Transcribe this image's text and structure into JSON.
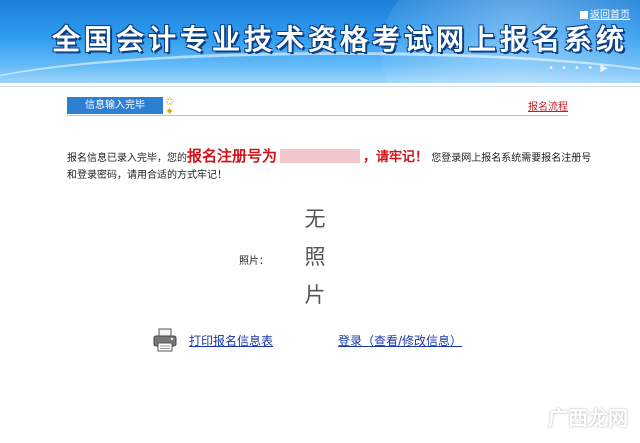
{
  "banner": {
    "title": "全国会计专业技术资格考试网上报名系统",
    "home_link": "返回首页"
  },
  "tab": {
    "label": "信息输入完毕",
    "process_link": "报名流程"
  },
  "message": {
    "part1": "报名信息已录入完毕，您的",
    "reg_label": "报名注册号为",
    "remember": "，请牢记！",
    "part2": "您登录网上报名系统需要报名注册号和登录密码，请用合适的方式牢记！"
  },
  "photo": {
    "label": "照片：",
    "line1": "无",
    "line2": "照",
    "line3": "片"
  },
  "actions": {
    "print_label": "打印报名信息表",
    "login_label": "登录（查看/修改信息）"
  },
  "watermark": "广西龙网",
  "colors": {
    "banner_blue": "#2f9cf0",
    "tab_blue": "#2d7fd3",
    "alert_red": "#d0141c",
    "link_blue": "#1a36a8"
  }
}
